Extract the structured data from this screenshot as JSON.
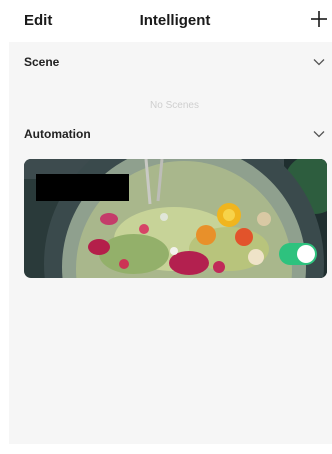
{
  "header": {
    "edit_label": "Edit",
    "title": "Intelligent",
    "add_icon": "plus-icon"
  },
  "sections": {
    "scene": {
      "title": "Scene",
      "chevron_icon": "chevron-down-icon",
      "empty_text": "No Scenes"
    },
    "automation": {
      "title": "Automation",
      "chevron_icon": "chevron-down-icon",
      "cards": [
        {
          "enabled": true,
          "background": "food-salad-image"
        }
      ]
    }
  },
  "colors": {
    "toggle_on": "#2ec27e",
    "content_bg": "#f6f6f6"
  }
}
